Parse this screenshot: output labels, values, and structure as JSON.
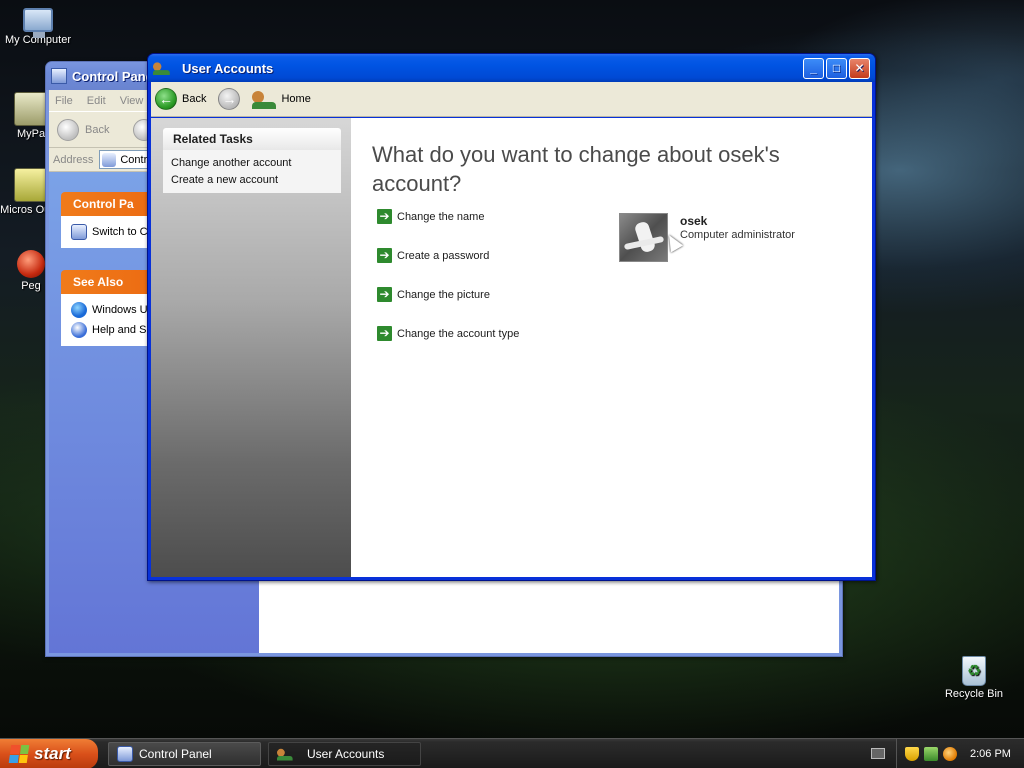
{
  "desktop": {
    "icons": [
      {
        "label": "My Computer"
      },
      {
        "label": "MyPa"
      },
      {
        "label": "Micros Outlo"
      },
      {
        "label": "Peg"
      },
      {
        "label": "Recycle Bin"
      }
    ]
  },
  "control_panel": {
    "title": "Control Panel",
    "menu": [
      "File",
      "Edit",
      "View"
    ],
    "back_label": "Back",
    "address_label": "Address",
    "address_value": "Contr",
    "box1_title": "Control Pa",
    "box1_link": "Switch to C",
    "box2_title": "See Also",
    "box2_links": [
      "Windows U",
      "Help and S"
    ]
  },
  "user_accounts": {
    "title": "User Accounts",
    "nav": {
      "back": "Back",
      "home": "Home"
    },
    "related_tasks": {
      "title": "Related Tasks",
      "links": [
        "Change another account",
        "Create a new account"
      ]
    },
    "heading": "What do you want to change about osek's account?",
    "tasks": [
      "Change the name",
      "Create a password",
      "Change the picture",
      "Change the account type"
    ],
    "account": {
      "name": "osek",
      "type": "Computer administrator"
    }
  },
  "taskbar": {
    "start_label": "start",
    "buttons": [
      "Control Panel",
      "User Accounts"
    ],
    "clock": "2:06 PM"
  },
  "colors": {
    "xp_blue": "#0054e3",
    "task_arrow_green": "#2e8a2e",
    "start_orange": "#d9501a",
    "see_also_orange": "#e85c0c"
  }
}
